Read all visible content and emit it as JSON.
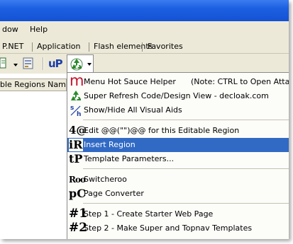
{
  "menubar": {
    "items": [
      {
        "label": "dow"
      },
      {
        "label": "Help"
      }
    ]
  },
  "tabs": [
    {
      "label": "P.NET"
    },
    {
      "label": "Application"
    },
    {
      "label": "Flash elements"
    },
    {
      "label": "Favorites"
    }
  ],
  "toolbar": {
    "buttons": [
      {
        "icon": "page-icon"
      },
      {
        "icon": "form-icon"
      },
      {
        "icon": "up-icon",
        "text": "uP"
      },
      {
        "icon": "recycle-icon"
      }
    ]
  },
  "panel": {
    "header": "ble Regions Nam"
  },
  "dropdown": {
    "items": [
      {
        "icon": "m-logo-icon",
        "label": "Menu Hot Sauce Helper",
        "note": "(Note: CTRL to Open Attach"
      },
      {
        "icon": "recycle-icon",
        "label": "Super Refresh Code/Design View - decloak.com"
      },
      {
        "icon": "show-hide-icon",
        "label": "Show/Hide All Visual Aids"
      },
      {
        "icon": "4at-icon",
        "glyph": "4@",
        "label": "Edit @@(\"\")@@ for this Editable Region"
      },
      {
        "icon": "ir-icon",
        "glyph": "iR",
        "label": "Insert Region",
        "highlighted": true
      },
      {
        "icon": "tp-icon",
        "glyph": "tP",
        "label": "Template Parameters..."
      },
      {
        "icon": "roo-icon",
        "glyph": "Roo",
        "label": "Switcheroo"
      },
      {
        "icon": "pc-icon",
        "glyph": "pC",
        "label": "Page Converter"
      },
      {
        "icon": "step1-icon",
        "glyph": "#1",
        "label": "Step 1 - Create Starter Web Page"
      },
      {
        "icon": "step2-icon",
        "glyph": "#2",
        "label": "Step 2 - Make Super and Topnav Templates"
      }
    ]
  },
  "colors": {
    "titlebar": "#1c5fe0",
    "highlight": "#316ac5",
    "menu_bg": "#fcfcf9",
    "chrome": "#ece9d8",
    "m_logo": "#c8102e",
    "recycle": "#2a8a2a"
  }
}
